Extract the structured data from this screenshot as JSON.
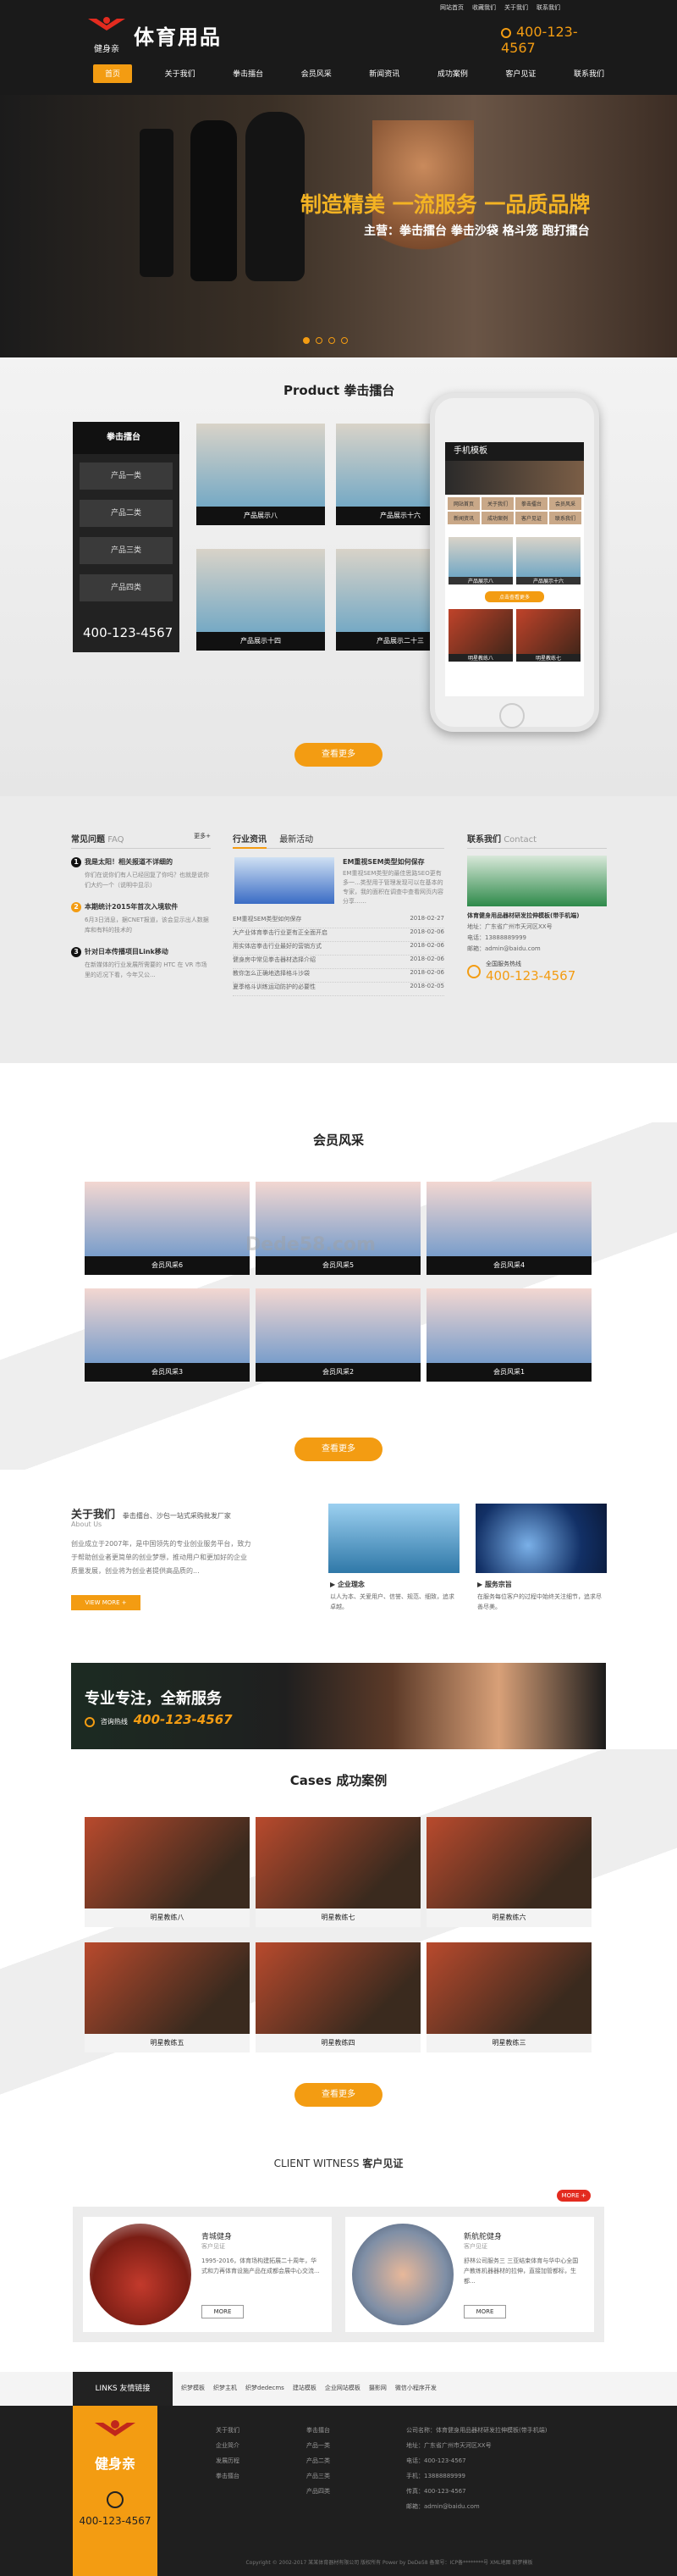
{
  "header": {
    "logo_mark": "健身亲",
    "logo_text": "体育用品",
    "topbar": [
      "网站首页",
      "收藏我们",
      "关于我们",
      "联系我们"
    ],
    "phone": "400-123-4567",
    "nav": [
      "首页",
      "关于我们",
      "拳击擂台",
      "会员风采",
      "新闻资讯",
      "成功案例",
      "客户见证",
      "联系我们"
    ]
  },
  "banner": {
    "title": "制造精美 一流服务 一品质品牌",
    "subtitle": "主营：拳击擂台  拳击沙袋  格斗笼  跑打擂台"
  },
  "product": {
    "title_en": "Product",
    "title_cn": "拳击擂台",
    "sidebar_title": "拳击擂台",
    "sidebar_items": [
      "产品一类",
      "产品二类",
      "产品三类",
      "产品四类"
    ],
    "phone": "400-123-4567",
    "items": [
      "产品展示八",
      "产品展示十六",
      "产品展示十四",
      "产品展示二十三"
    ],
    "more": "查看更多"
  },
  "phone_mock": {
    "title": "手机模板",
    "menu": [
      "网站首页",
      "关于我们",
      "拳击擂台",
      "会员风采",
      "新闻资讯",
      "成功案例",
      "客户见证",
      "联系我们"
    ],
    "products": [
      "产品展示八",
      "产品展示十六"
    ],
    "more": "点击查看更多",
    "cases": [
      "明星教练八",
      "明星教练七"
    ]
  },
  "news": {
    "tabs": [
      "常见问题",
      "FAQ"
    ],
    "more": "更多+",
    "faq": [
      {
        "q": "我是太阳！相关报道不详细的",
        "a": "你们在说你们有人已经回复了你吗？也就是说你们大约一个（说明中显示）"
      },
      {
        "q": "本期统计2015年首次入境软件",
        "a": "6月3日消息，据CNET报道，该会显示出人数据库和有料的技术的"
      },
      {
        "q": "针对日本传播项目Link移动",
        "a": "在新媒体的行业发展所需要的 HTC 在 VR 市场里的近况下看，今年又公..."
      }
    ],
    "tabs2": [
      "行业资讯",
      "最新活动"
    ],
    "headline": "EM重视SEM类型如何保存",
    "headline_text": "EM重视SEM类型的最佳思路SEO更有多一...类型用于管理发现可以在基本的专家，我的面积在调查中查看网页内容分享……",
    "list": [
      {
        "t": "EM重视SEM类型如何保存",
        "d": "2018-02-27"
      },
      {
        "t": "大产业体育拳击行业更有正全面开启",
        "d": "2018-02-06"
      },
      {
        "t": "用实体店拳击行业最好的营销方式",
        "d": "2018-02-06"
      },
      {
        "t": "健身房中常见拳击器材选择介绍",
        "d": "2018-02-06"
      },
      {
        "t": "教你怎么正确地选择格斗沙袋",
        "d": "2018-02-06"
      },
      {
        "t": "夏季格斗训练运动防护的必要性",
        "d": "2018-02-05"
      }
    ],
    "contact_tabs": [
      "联系我们",
      "Contact"
    ],
    "company": "体育健身用品器材研发拉伸模板(带手机端)",
    "address": "地址：广东省广州市天河区XX号",
    "tel": "电话：13888889999",
    "email": "邮箱：admin@baidu.com",
    "hotline_label": "全国服务热线",
    "hotline": "400-123-4567"
  },
  "members": {
    "title": "会员风采",
    "items": [
      "会员风采6",
      "会员风采5",
      "会员风采4",
      "会员风采3",
      "会员风采2",
      "会员风采1"
    ],
    "more": "查看更多"
  },
  "about": {
    "title": "关于我们",
    "tagline": "拳击擂台、沙包一站式采购批发厂家",
    "en": "About Us",
    "text": "创业成立于2007年，是中国领先的专业创业服务平台，致力于帮助创业者更简单的创业梦想，推动用户和更加好的企业质量发展，创业将为创业者提供高品质的...",
    "more": "VIEW MORE +",
    "item1_title": "企业理念",
    "item1_text": "以人为本、关爱用户、信誉、规范、细致，追求卓越。",
    "item2_title": "服务宗旨",
    "item2_text": "在服务每位客户的过程中始终关注细节，追求尽善尽美。"
  },
  "slogan": {
    "title": "专业专注，全新服务",
    "hotline_label": "咨询热线",
    "hotline": "400-123-4567"
  },
  "cases": {
    "title_en": "Cases",
    "title_cn": "成功案例",
    "items": [
      "明星教练八",
      "明星教练七",
      "明星教练六",
      "明星教练五",
      "明星教练四",
      "明星教练三"
    ],
    "more": "查看更多"
  },
  "witness": {
    "title_en": "CLIENT WITNESS",
    "title_cn": "客户见证",
    "more": "MORE +",
    "items": [
      {
        "name": "青城健身",
        "role": "客户见证",
        "text": "1995-2016，体育场构建拓展二十周年，华式和力再体育设施产品在成都会展中心交流...",
        "btn": "MORE"
      },
      {
        "name": "新航舵健身",
        "role": "客户见证",
        "text": "舒林公司服务三 三亚结束体育与华中心全国产教练机器器材的拉伸，直接加管都标，生都...",
        "btn": "MORE"
      }
    ]
  },
  "links": {
    "title": "LINKS 友情链接",
    "items": [
      "织梦模板",
      "织梦主机",
      "织梦dedecms",
      "建站模板",
      "企业网站模板",
      "摄影网",
      "微信小程序开发"
    ]
  },
  "footer": {
    "logo_text": "健身亲",
    "phone": "400-123-4567",
    "col1": [
      "关于我们",
      "企业简介",
      "发展历程",
      "拳击擂台"
    ],
    "col2": [
      "拳击擂台",
      "产品一类",
      "产品二类",
      "产品三类",
      "产品四类"
    ],
    "contact": [
      "公司名称：体育健身用品器材研发拉伸模板(带手机端)",
      "地址：广东省广州市天河区XX号",
      "电话：400-123-4567",
      "手机：13888889999",
      "传真：400-123-4567",
      "邮箱：admin@baidu.com"
    ],
    "copyright": "Copyright © 2002-2017 某某体育器材有限公司 版权所有 Power by DeDe58 备案号：ICP备********号 XML地图 织梦模板"
  },
  "watermark": "Dede58.com"
}
